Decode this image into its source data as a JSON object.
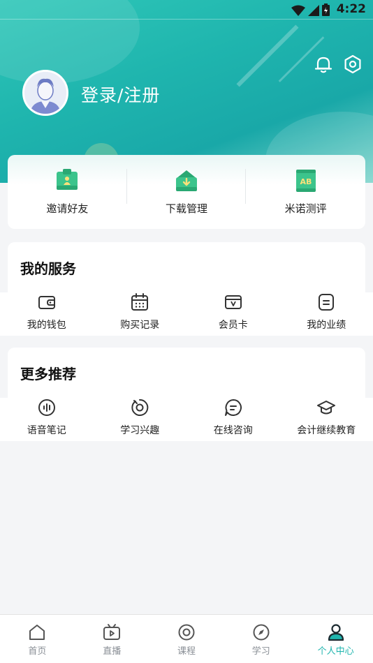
{
  "status_bar": {
    "time": "4:22"
  },
  "header": {
    "login_label": "登录/注册"
  },
  "quick_actions": [
    {
      "label": "邀请好友",
      "icon": "invite-friend-icon"
    },
    {
      "label": "下载管理",
      "icon": "download-icon"
    },
    {
      "label": "米诺测评",
      "icon": "assessment-icon"
    }
  ],
  "my_services": {
    "title": "我的服务",
    "items": [
      {
        "label": "我的钱包",
        "icon": "wallet-icon"
      },
      {
        "label": "购买记录",
        "icon": "calendar-icon"
      },
      {
        "label": "会员卡",
        "icon": "vip-card-icon"
      },
      {
        "label": "我的业绩",
        "icon": "performance-icon"
      }
    ]
  },
  "more_recommend": {
    "title": "更多推荐",
    "items": [
      {
        "label": "语音笔记",
        "icon": "voice-note-icon"
      },
      {
        "label": "学习兴趣",
        "icon": "interest-icon"
      },
      {
        "label": "在线咨询",
        "icon": "chat-icon"
      },
      {
        "label": "会计继续教育",
        "icon": "graduation-cap-icon"
      }
    ]
  },
  "tabbar": {
    "tabs": [
      {
        "label": "首页",
        "icon": "home-icon",
        "active": false
      },
      {
        "label": "直播",
        "icon": "live-tv-icon",
        "active": false
      },
      {
        "label": "课程",
        "icon": "course-icon",
        "active": false
      },
      {
        "label": "学习",
        "icon": "compass-icon",
        "active": false
      },
      {
        "label": "个人中心",
        "icon": "profile-icon",
        "active": true
      }
    ]
  },
  "colors": {
    "accent": "#1fb5ae",
    "tab_inactive": "#8a8f96",
    "background": "#f4f5f7"
  }
}
